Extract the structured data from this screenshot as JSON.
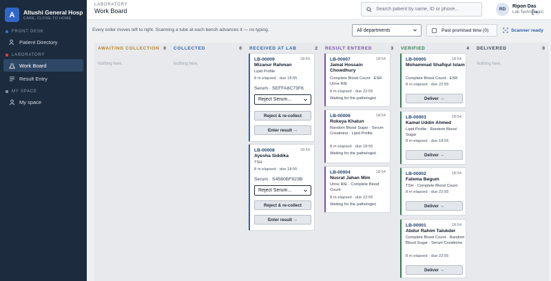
{
  "brand": {
    "logo_letter": "A",
    "name": "Altushi General Hospital",
    "tagline": "CARE, CLOSE TO HOME"
  },
  "nav": [
    {
      "type": "section",
      "label": "FRONT DESK",
      "color": "#3b6fc9"
    },
    {
      "type": "item",
      "label": "Patient Directory",
      "icon": "people-icon",
      "active": false
    },
    {
      "type": "section",
      "label": "LABORATORY",
      "color": "#d94040"
    },
    {
      "type": "item",
      "label": "Work Board",
      "icon": "flask-icon",
      "active": true
    },
    {
      "type": "item",
      "label": "Result Entry",
      "icon": "list-icon",
      "active": false
    },
    {
      "type": "section",
      "label": "MY SPACE",
      "color": "#8a95a3"
    },
    {
      "type": "item",
      "label": "My space",
      "icon": "person-icon",
      "active": false
    }
  ],
  "header": {
    "kicker": "LABORATORY",
    "title": "Work Board",
    "search_placeholder": "Search patient by name, ID or phone...",
    "user": {
      "initials": "RD",
      "name": "Ripon Das",
      "role": "Lab Technologist"
    }
  },
  "toolbar": {
    "hint": "Every order moves left to right. Scanning a tube at each bench advances it — no typing.",
    "department": "All departments",
    "promised_label": "Past promised time (0)",
    "scanner_label": "Scanner ready"
  },
  "columns": [
    {
      "title": "AWAITING COLLECTION",
      "count": "0",
      "color": "#b6822a",
      "empty_text": "Nothing here.",
      "cards": []
    },
    {
      "title": "COLLECTED",
      "count": "0",
      "color": "#2f5fa8",
      "empty_text": "Nothing here.",
      "cards": []
    },
    {
      "title": "RECEIVED AT LAB",
      "count": "2",
      "color": "#2f5fa8",
      "empty_text": "",
      "cards": [
        {
          "id": "LB-00009",
          "time": "18:54",
          "name": "Mizanur Rahman",
          "tests": "Lipid Profile",
          "meta": "8 m elapsed · due 18:55",
          "serum": "Serum · SEFFA8C73F6",
          "reject_select": "Reject Serum...",
          "buttons": [
            "Reject & re-collect",
            "Enter result →"
          ]
        },
        {
          "id": "LB-00008",
          "time": "18:54",
          "name": "Ayesha Siddika",
          "tests": "TSH",
          "meta": "8 m elapsed · due 18:55",
          "serum": "Serum · S4580BF923B",
          "reject_select": "Reject Serum...",
          "buttons": [
            "Reject & re-collect",
            "Enter result →"
          ]
        }
      ]
    },
    {
      "title": "RESULT ENTERED",
      "count": "3",
      "color": "#7a4ea8",
      "empty_text": "",
      "cards": [
        {
          "id": "LB-00007",
          "time": "18:54",
          "name": "Jamal Hossain Chowdhury",
          "tests": "Complete Blood Count · ESR · Urine R/E",
          "meta": "8 m elapsed · due 22:55",
          "wait": "Waiting for the pathologist"
        },
        {
          "id": "LB-00006",
          "time": "18:54",
          "name": "Rokeya Khatun",
          "tests": "Random Blood Sugar · Serum Creatinine · Lipid Profile",
          "meta": "8 m elapsed · due 18:55",
          "wait": "Waiting for the pathologist"
        },
        {
          "id": "LB-00004",
          "time": "18:54",
          "name": "Nusrat Jahan Mim",
          "tests": "Urine R/E · Complete Blood Count",
          "meta": "8 m elapsed · due 22:55",
          "wait": "Waiting for the pathologist"
        }
      ]
    },
    {
      "title": "VERIFIED",
      "count": "4",
      "color": "#2e7d4f",
      "empty_text": "",
      "cards": [
        {
          "id": "LB-00005",
          "time": "18:54",
          "name": "Mohammad Shafiqul Islam",
          "tests": "Complete Blood Count · ESR",
          "meta": "8 m elapsed · due 22:55",
          "buttons": [
            "Deliver →"
          ]
        },
        {
          "id": "LB-00003",
          "time": "18:54",
          "name": "Kamal Uddin Ahmed",
          "tests": "Lipid Profile · Random Blood Sugar",
          "meta": "8 m elapsed · due 18:55",
          "buttons": [
            "Deliver →"
          ]
        },
        {
          "id": "LB-00002",
          "time": "18:54",
          "name": "Fatema Begum",
          "tests": "TSH · Complete Blood Count",
          "meta": "8 m elapsed · due 22:55",
          "buttons": [
            "Deliver →"
          ]
        },
        {
          "id": "LB-00001",
          "time": "18:54",
          "name": "Abdur Rahim Talukder",
          "tests": "Complete Blood Count · Random Blood Sugar · Serum Creatinine",
          "meta": "8 m elapsed · due 22:55",
          "buttons": [
            "Deliver →"
          ]
        }
      ]
    },
    {
      "title": "DELIVERED",
      "count": "0",
      "color": "#374151",
      "empty_text": "Nothing here.",
      "cards": []
    }
  ]
}
